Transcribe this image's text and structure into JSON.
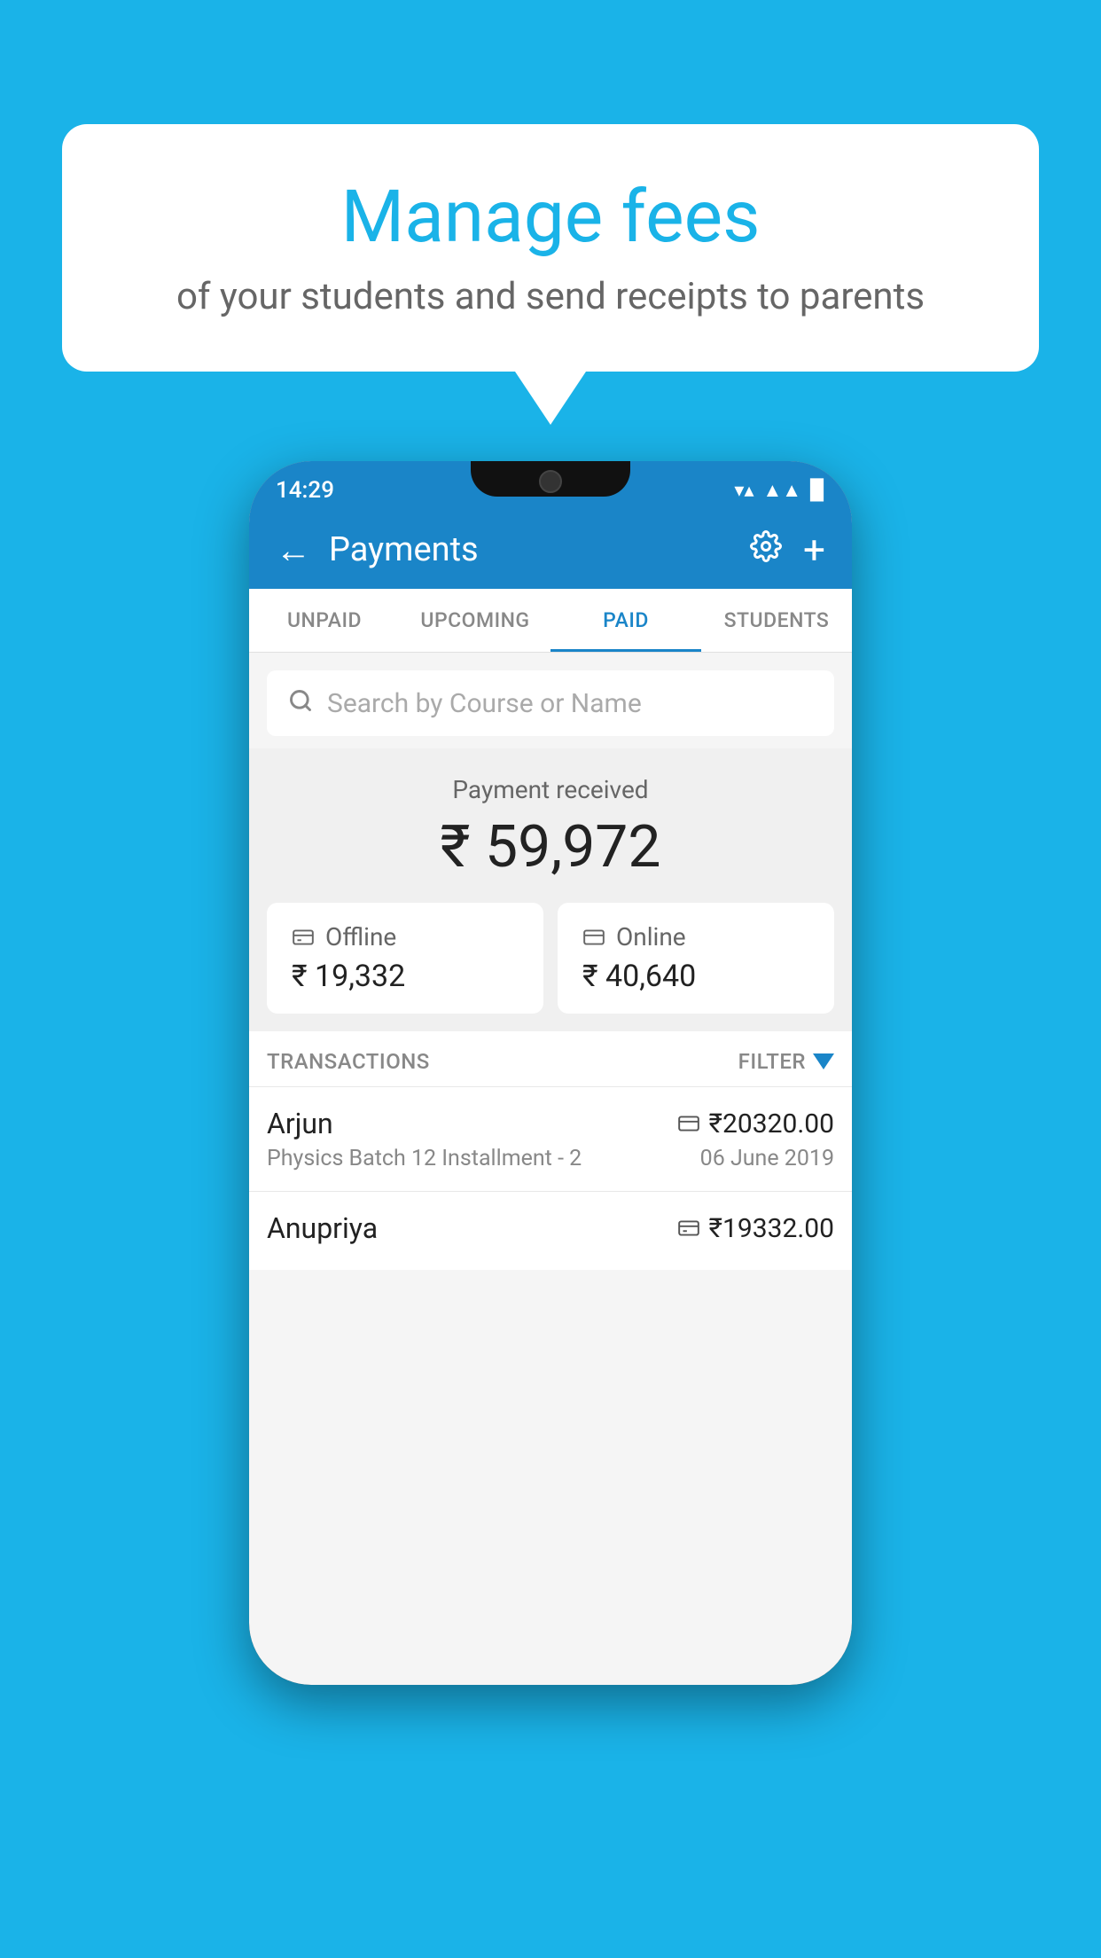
{
  "background_color": "#1ab3e8",
  "speech_bubble": {
    "title": "Manage fees",
    "subtitle": "of your students and send receipts to parents"
  },
  "status_bar": {
    "time": "14:29",
    "wifi": "▼",
    "signal": "▲",
    "battery": "▉"
  },
  "header": {
    "title": "Payments",
    "back_label": "←",
    "plus_label": "+"
  },
  "tabs": [
    {
      "label": "UNPAID",
      "active": false
    },
    {
      "label": "UPCOMING",
      "active": false
    },
    {
      "label": "PAID",
      "active": true
    },
    {
      "label": "STUDENTS",
      "active": false
    }
  ],
  "search": {
    "placeholder": "Search by Course or Name"
  },
  "payment_summary": {
    "label": "Payment received",
    "amount": "₹ 59,972",
    "offline_label": "Offline",
    "offline_amount": "₹ 19,332",
    "online_label": "Online",
    "online_amount": "₹ 40,640"
  },
  "transactions": {
    "section_label": "TRANSACTIONS",
    "filter_label": "FILTER",
    "rows": [
      {
        "name": "Arjun",
        "detail": "Physics Batch 12 Installment - 2",
        "amount": "₹20320.00",
        "date": "06 June 2019",
        "payment_type": "card"
      },
      {
        "name": "Anupriya",
        "detail": "",
        "amount": "₹19332.00",
        "date": "",
        "payment_type": "rupee"
      }
    ]
  }
}
